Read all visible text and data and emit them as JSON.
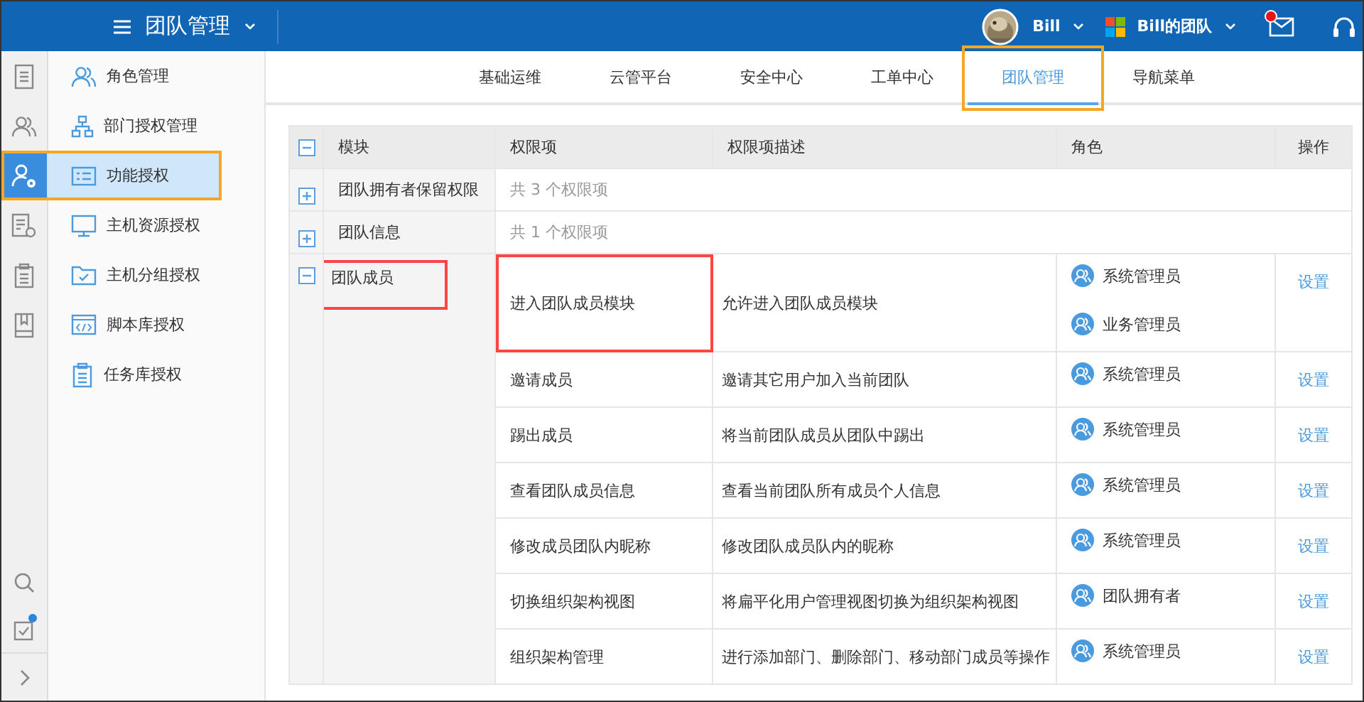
{
  "header": {
    "title": "团队管理",
    "user": "Bill",
    "team": "Bill的团队",
    "mail_badge": true
  },
  "rail": [
    {
      "kind": "document",
      "selected": false
    },
    {
      "kind": "people",
      "selected": false
    },
    {
      "kind": "user-gear",
      "selected": true
    },
    {
      "kind": "list-gear",
      "selected": false
    },
    {
      "kind": "clipboard",
      "selected": false
    },
    {
      "kind": "book",
      "selected": false
    }
  ],
  "rail_bottom": [
    {
      "kind": "search",
      "badge": false
    },
    {
      "kind": "task",
      "badge": true
    },
    {
      "kind": "expand",
      "badge": false
    }
  ],
  "sidebar": {
    "items": [
      {
        "label": "角色管理",
        "kind": "people",
        "selected": false,
        "highlighted": false
      },
      {
        "label": "部门授权管理",
        "kind": "org",
        "selected": false,
        "highlighted": false
      },
      {
        "label": "功能授权",
        "kind": "list",
        "selected": true,
        "highlighted": true
      },
      {
        "label": "主机资源授权",
        "kind": "monitor",
        "selected": false,
        "highlighted": false
      },
      {
        "label": "主机分组授权",
        "kind": "folder",
        "selected": false,
        "highlighted": false
      },
      {
        "label": "脚本库授权",
        "kind": "code",
        "selected": false,
        "highlighted": false
      },
      {
        "label": "任务库授权",
        "kind": "clipboard",
        "selected": false,
        "highlighted": false
      }
    ]
  },
  "tabs": [
    {
      "label": "基础运维",
      "selected": false,
      "highlighted": false
    },
    {
      "label": "云管平台",
      "selected": false,
      "highlighted": false
    },
    {
      "label": "安全中心",
      "selected": false,
      "highlighted": false
    },
    {
      "label": "工单中心",
      "selected": false,
      "highlighted": false
    },
    {
      "label": "团队管理",
      "selected": true,
      "highlighted": true
    },
    {
      "label": "导航菜单",
      "selected": false,
      "highlighted": false
    }
  ],
  "table": {
    "expanded": true,
    "columns": [
      "模块",
      "权限项",
      "权限项描述",
      "角色",
      "操作"
    ],
    "groups": [
      {
        "module": "团队拥有者保留权限",
        "expanded": false,
        "highlighted": false,
        "summary": "共 3 个权限项"
      },
      {
        "module": "团队信息",
        "expanded": false,
        "highlighted": false,
        "summary": "共 1 个权限项"
      },
      {
        "module": "团队成员",
        "expanded": true,
        "highlighted": true,
        "items": [
          {
            "name": "进入团队成员模块",
            "description": "允许进入团队成员模块",
            "roles": [
              "系统管理员",
              "业务管理员"
            ],
            "action": "设置",
            "highlighted": true
          },
          {
            "name": "邀请成员",
            "description": "邀请其它用户加入当前团队",
            "roles": [
              "系统管理员"
            ],
            "action": "设置",
            "highlighted": false
          },
          {
            "name": "踢出成员",
            "description": "将当前团队成员从团队中踢出",
            "roles": [
              "系统管理员"
            ],
            "action": "设置",
            "highlighted": false
          },
          {
            "name": "查看团队成员信息",
            "description": "查看当前团队所有成员个人信息",
            "roles": [
              "系统管理员"
            ],
            "action": "设置",
            "highlighted": false
          },
          {
            "name": "修改成员团队内昵称",
            "description": "修改团队成员队内的昵称",
            "roles": [
              "系统管理员"
            ],
            "action": "设置",
            "highlighted": false
          },
          {
            "name": "切换组织架构视图",
            "description": "将扁平化用户管理视图切换为组织架构视图",
            "roles": [
              "团队拥有者"
            ],
            "action": "设置",
            "highlighted": false
          },
          {
            "name": "组织架构管理",
            "description": "进行添加部门、删除部门、移动部门成员等操作",
            "roles": [
              "系统管理员"
            ],
            "action": "设置",
            "highlighted": false
          }
        ]
      }
    ]
  }
}
